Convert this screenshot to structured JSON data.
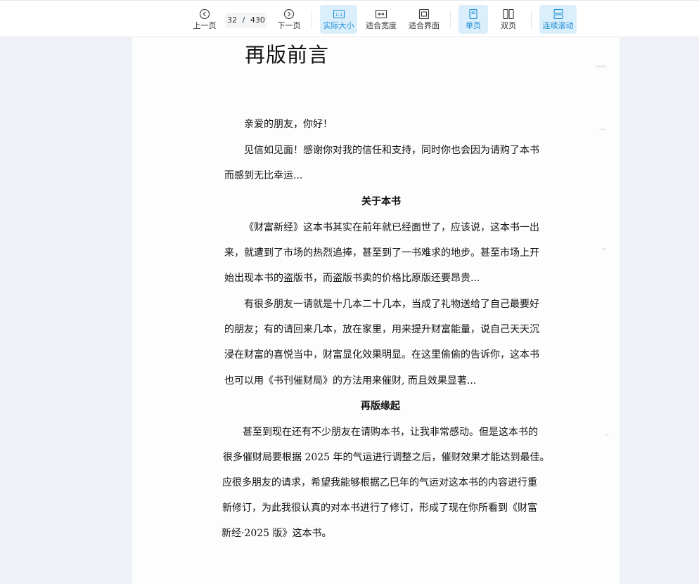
{
  "toolbar": {
    "prev_label": "上一页",
    "page_current": "32",
    "page_separator": "/",
    "page_total": "430",
    "next_label": "下一页",
    "actual_size_label": "实际大小",
    "fit_width_label": "适合宽度",
    "fit_page_label": "适合界面",
    "single_page_label": "单页",
    "double_page_label": "双页",
    "continuous_label": "连续滚动",
    "active_color": "#1a8fd6",
    "active_bg": "#dbeefb"
  },
  "document": {
    "title": "再版前言",
    "greeting": "亲爱的朋友，你好！",
    "para1": [
      "见信如见面！感谢你对我的信任和支持，同时你也会因为请购了本书",
      "而感到无比幸运..."
    ],
    "heading1": "关于本书",
    "para2": [
      "《财富新经》这本书其实在前年就已经面世了，应该说，这本书一出",
      "来，就遭到了市场的热烈追捧，甚至到了一书难求的地步。甚至市场上开",
      "始出现本书的盗版书，而盗版书卖的价格比原版还要昂贵..."
    ],
    "para3": [
      "有很多朋友一请就是十几本二十几本，当成了礼物送给了自己最要好",
      "的朋友；有的请回来几本，放在家里，用来提升财富能量，说自己天天沉",
      "浸在财富的喜悦当中，财富显化效果明显。在这里偷偷的告诉你，这本书",
      "也可以用《书刊催财局》的方法用来催财, 而且效果显著..."
    ],
    "heading2": "再版缘起",
    "para4": [
      "甚至到现在还有不少朋友在请购本书，让我非常感动。但是这本书的",
      "很多催财局要根据 2025 年的气运进行调整之后，催财效果才能达到最佳。",
      "应很多朋友的请求，希望我能够根据乙巳年的气运对这本书的内容进行重",
      "新修订，为此我很认真的对本书进行了修订，形成了现在你所看到《财富",
      "新经·2025 版》这本书。"
    ]
  }
}
